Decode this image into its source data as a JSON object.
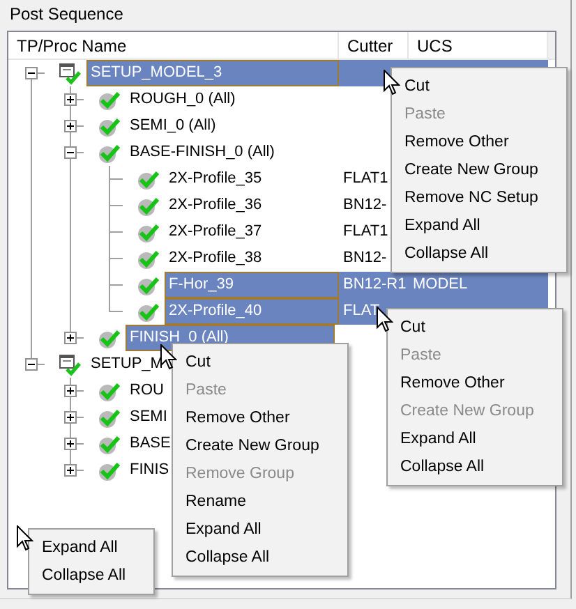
{
  "panel": {
    "title": "Post Sequence"
  },
  "columns": [
    "TP/Proc Name",
    "Cutter",
    "UCS"
  ],
  "tree": [
    {
      "name": "SETUP_MODEL_3",
      "kind": "setup",
      "selected": true,
      "expanded": true,
      "children": [
        {
          "name": "ROUGH_0 (All)",
          "kind": "check",
          "selected": false,
          "expanded": false
        },
        {
          "name": "SEMI_0 (All)",
          "kind": "check",
          "selected": false,
          "expanded": false
        },
        {
          "name": "BASE-FINISH_0 (All)",
          "kind": "check",
          "selected": false,
          "expanded": true,
          "children": [
            {
              "name": "2X-Profile_35",
              "kind": "check",
              "cutter": "FLAT1",
              "selected": false
            },
            {
              "name": "2X-Profile_36",
              "kind": "check",
              "cutter": "BN12-",
              "selected": false
            },
            {
              "name": "2X-Profile_37",
              "kind": "check",
              "cutter": "FLAT1",
              "selected": false
            },
            {
              "name": "2X-Profile_38",
              "kind": "check",
              "cutter": "BN12-",
              "selected": false
            },
            {
              "name": "F-Hor_39",
              "kind": "check",
              "cutter": "BN12-R1",
              "ucs": "MODEL",
              "selected": true
            },
            {
              "name": "2X-Profile_40",
              "kind": "check",
              "cutter": "FLAT",
              "selected": true
            }
          ]
        },
        {
          "name": "FINISH_0 (All)",
          "kind": "check",
          "selected": true,
          "expanded": false
        }
      ]
    },
    {
      "name": "SETUP_M",
      "kind": "setup",
      "selected": false,
      "expanded": true,
      "children": [
        {
          "name": "ROU",
          "kind": "check",
          "selected": false,
          "expanded": false
        },
        {
          "name": "SEMI",
          "kind": "check",
          "selected": false,
          "expanded": false
        },
        {
          "name": "BASE",
          "kind": "check",
          "selected": false,
          "expanded": false
        },
        {
          "name": "FINIS",
          "kind": "check",
          "selected": false,
          "expanded": false
        }
      ]
    }
  ],
  "context_menus": [
    {
      "items": [
        {
          "label": "Cut",
          "disabled": false
        },
        {
          "label": "Paste",
          "disabled": true
        },
        {
          "label": "Remove Other",
          "disabled": false
        },
        {
          "label": "Create New Group",
          "disabled": false
        },
        {
          "label": "Remove NC Setup",
          "disabled": false
        },
        {
          "label": "Expand All",
          "disabled": false
        },
        {
          "label": "Collapse All",
          "disabled": false
        }
      ]
    },
    {
      "items": [
        {
          "label": "Cut",
          "disabled": false
        },
        {
          "label": "Paste",
          "disabled": true
        },
        {
          "label": "Remove Other",
          "disabled": false
        },
        {
          "label": "Create New Group",
          "disabled": true
        },
        {
          "label": "Expand All",
          "disabled": false
        },
        {
          "label": "Collapse All",
          "disabled": false
        }
      ]
    },
    {
      "items": [
        {
          "label": "Cut",
          "disabled": false
        },
        {
          "label": "Paste",
          "disabled": true
        },
        {
          "label": "Remove Other",
          "disabled": false
        },
        {
          "label": "Create New Group",
          "disabled": false
        },
        {
          "label": "Remove Group",
          "disabled": true
        },
        {
          "label": "Rename",
          "disabled": false
        },
        {
          "label": "Expand All",
          "disabled": false
        },
        {
          "label": "Collapse All",
          "disabled": false
        }
      ]
    },
    {
      "items": [
        {
          "label": "Expand All",
          "disabled": false
        },
        {
          "label": "Collapse All",
          "disabled": false
        }
      ]
    }
  ]
}
